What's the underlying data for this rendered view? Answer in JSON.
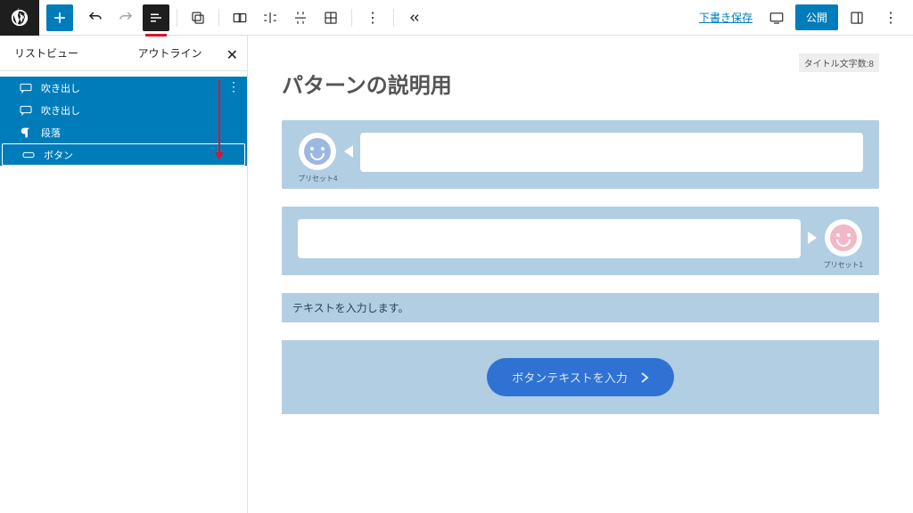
{
  "topbar": {
    "draft_save": "下書き保存",
    "publish": "公開"
  },
  "sidebar": {
    "tabs": {
      "list_view": "リストビュー",
      "outline": "アウトライン"
    },
    "items": [
      {
        "label": "吹き出し",
        "icon": "speech"
      },
      {
        "label": "吹き出し",
        "icon": "speech"
      },
      {
        "label": "段落",
        "icon": "paragraph"
      },
      {
        "label": "ボタン",
        "icon": "button"
      }
    ]
  },
  "content": {
    "char_count": "タイトル文字数:8",
    "title": "パターンの説明用",
    "preset4": "プリセット4",
    "preset1": "プリセット1",
    "text_input": "テキストを入力します。",
    "button_text": "ボタンテキストを入力"
  }
}
